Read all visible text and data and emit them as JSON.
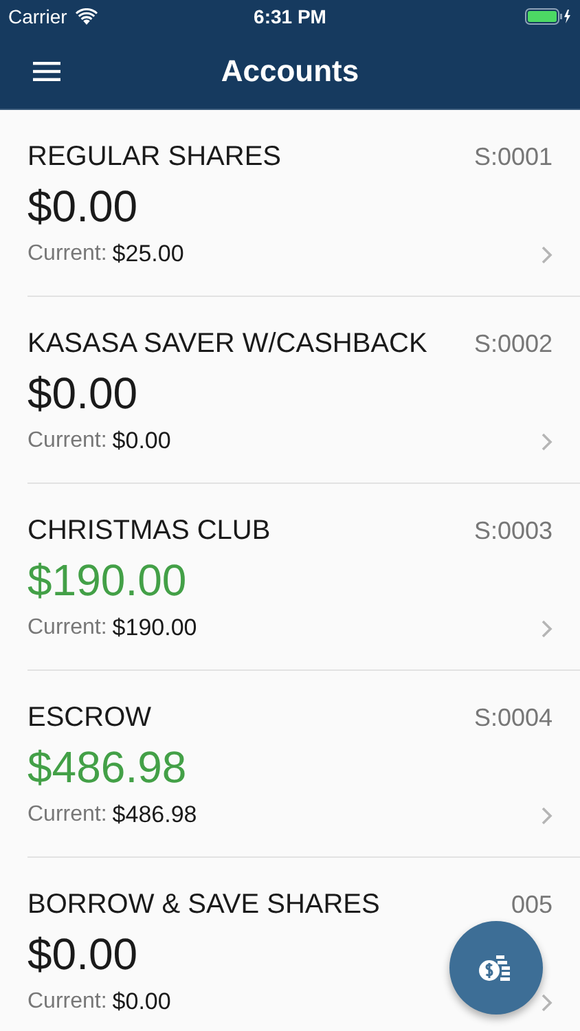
{
  "status_bar": {
    "carrier": "Carrier",
    "time": "6:31 PM"
  },
  "nav_bar": {
    "title": "Accounts"
  },
  "accounts": [
    {
      "name": "REGULAR SHARES",
      "id": "S:0001",
      "balance": "$0.00",
      "color": "#1a1a1a",
      "current_label": "Current:",
      "current": "$25.00"
    },
    {
      "name": "KASASA SAVER W/CASHBACK",
      "id": "S:0002",
      "balance": "$0.00",
      "color": "#1a1a1a",
      "current_label": "Current:",
      "current": "$0.00"
    },
    {
      "name": "CHRISTMAS CLUB",
      "id": "S:0003",
      "balance": "$190.00",
      "color": "#43a047",
      "current_label": "Current:",
      "current": "$190.00"
    },
    {
      "name": "ESCROW",
      "id": "S:0004",
      "balance": "$486.98",
      "color": "#43a047",
      "current_label": "Current:",
      "current": "$486.98"
    },
    {
      "name": "BORROW & SAVE SHARES",
      "id": "005",
      "balance": "$0.00",
      "color": "#1a1a1a",
      "current_label": "Current:",
      "current": "$0.00"
    }
  ]
}
